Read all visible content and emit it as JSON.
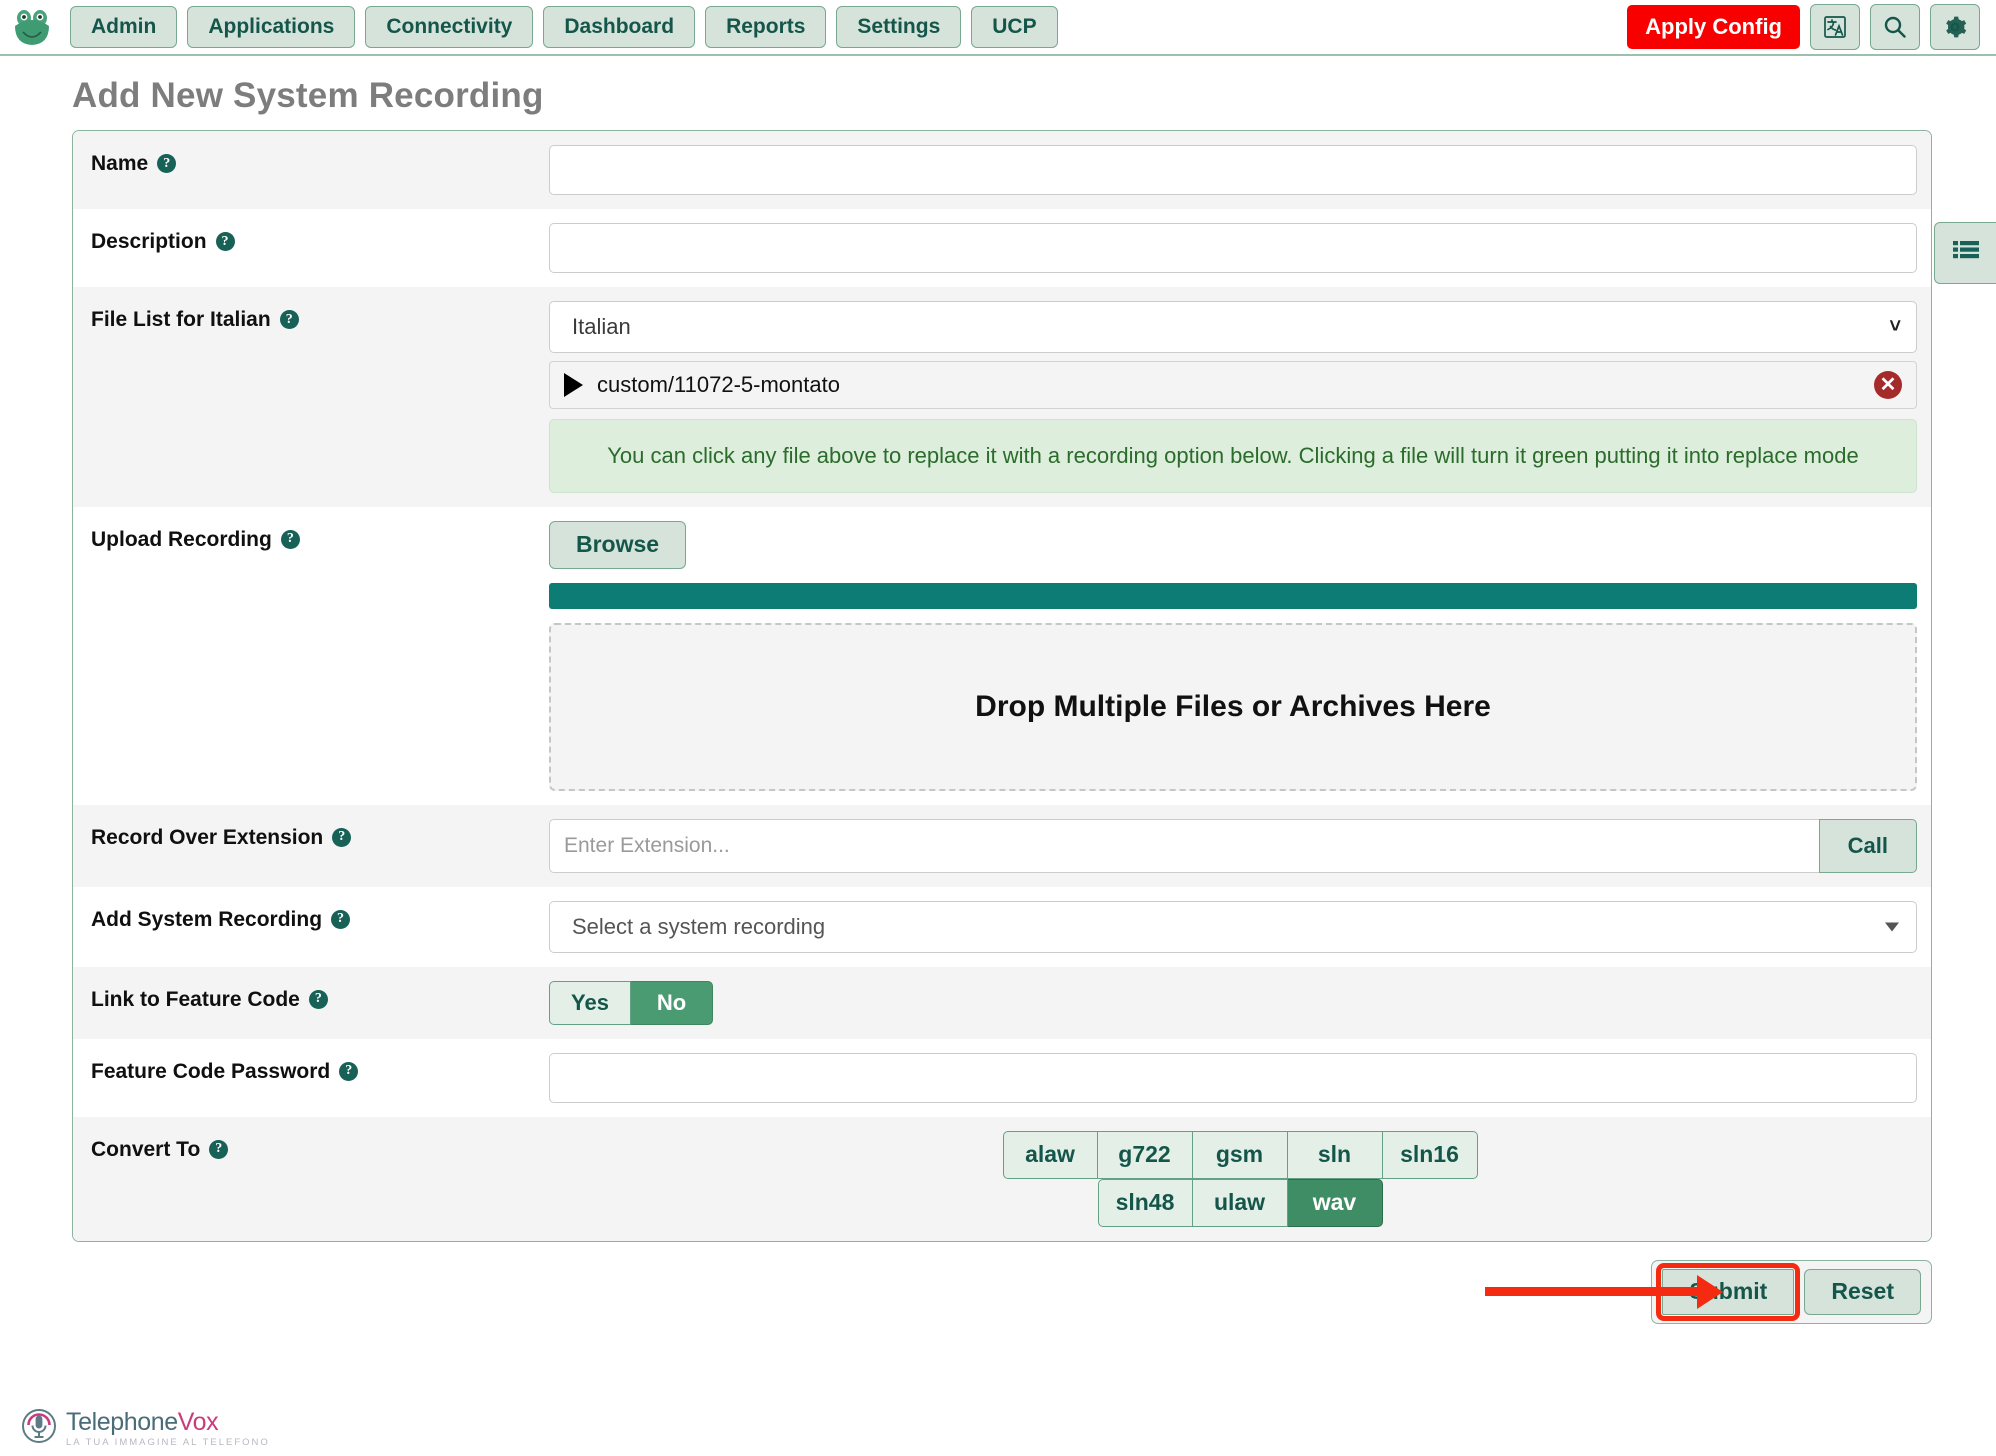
{
  "header": {
    "logo_alt": "frog-logo",
    "nav_items": [
      {
        "label": "Admin"
      },
      {
        "label": "Applications"
      },
      {
        "label": "Connectivity"
      },
      {
        "label": "Dashboard"
      },
      {
        "label": "Reports"
      },
      {
        "label": "Settings"
      },
      {
        "label": "UCP"
      }
    ],
    "apply_config_label": "Apply Config",
    "apply_config_color": "#f80000",
    "translate_icon": "translate-icon",
    "search_icon": "search-icon",
    "gear_icon": "gear-icon"
  },
  "page": {
    "title": "Add New System Recording"
  },
  "side_tab": {
    "icon": "list-icon"
  },
  "form": {
    "name": {
      "label": "Name",
      "value": "",
      "placeholder": ""
    },
    "description": {
      "label": "Description",
      "value": "",
      "placeholder": ""
    },
    "file_list": {
      "label": "File List for Italian",
      "language_selected": "Italian",
      "files": [
        {
          "name": "custom/11072-5-montato",
          "play_icon": "play-icon",
          "delete_icon": "delete-icon"
        }
      ],
      "notice": "You can click any file above to replace it with a recording option below. Clicking a file will turn it green putting it into replace mode",
      "notice_color": "#2b6b2b"
    },
    "upload_recording": {
      "label": "Upload Recording",
      "browse_label": "Browse",
      "progress_percent": 100,
      "progress_color": "#0d7c74",
      "dropzone_text": "Drop Multiple Files or Archives Here"
    },
    "record_over_extension": {
      "label": "Record Over Extension",
      "value": "",
      "placeholder": "Enter Extension...",
      "call_label": "Call"
    },
    "add_system_recording": {
      "label": "Add System Recording",
      "selected": "Select a system recording"
    },
    "link_to_feature_code": {
      "label": "Link to Feature Code",
      "options": [
        {
          "label": "Yes",
          "active": false
        },
        {
          "label": "No",
          "active": true
        }
      ]
    },
    "feature_code_password": {
      "label": "Feature Code Password",
      "value": "",
      "placeholder": ""
    },
    "convert_to": {
      "label": "Convert To",
      "row1": [
        {
          "label": "alaw",
          "active": false
        },
        {
          "label": "g722",
          "active": false
        },
        {
          "label": "gsm",
          "active": false
        },
        {
          "label": "sln",
          "active": false
        },
        {
          "label": "sln16",
          "active": false
        }
      ],
      "row2": [
        {
          "label": "sln48",
          "active": false
        },
        {
          "label": "ulaw",
          "active": false
        },
        {
          "label": "wav",
          "active": true
        }
      ]
    }
  },
  "actions": {
    "submit_label": "Submit",
    "reset_label": "Reset",
    "annotation_color": "#f42b10"
  },
  "footer": {
    "brand_part1": "Telephone",
    "brand_part2": "Vox",
    "tagline": "LA TUA IMMAGINE AL TELEFONO",
    "icon": "microphone-icon"
  }
}
